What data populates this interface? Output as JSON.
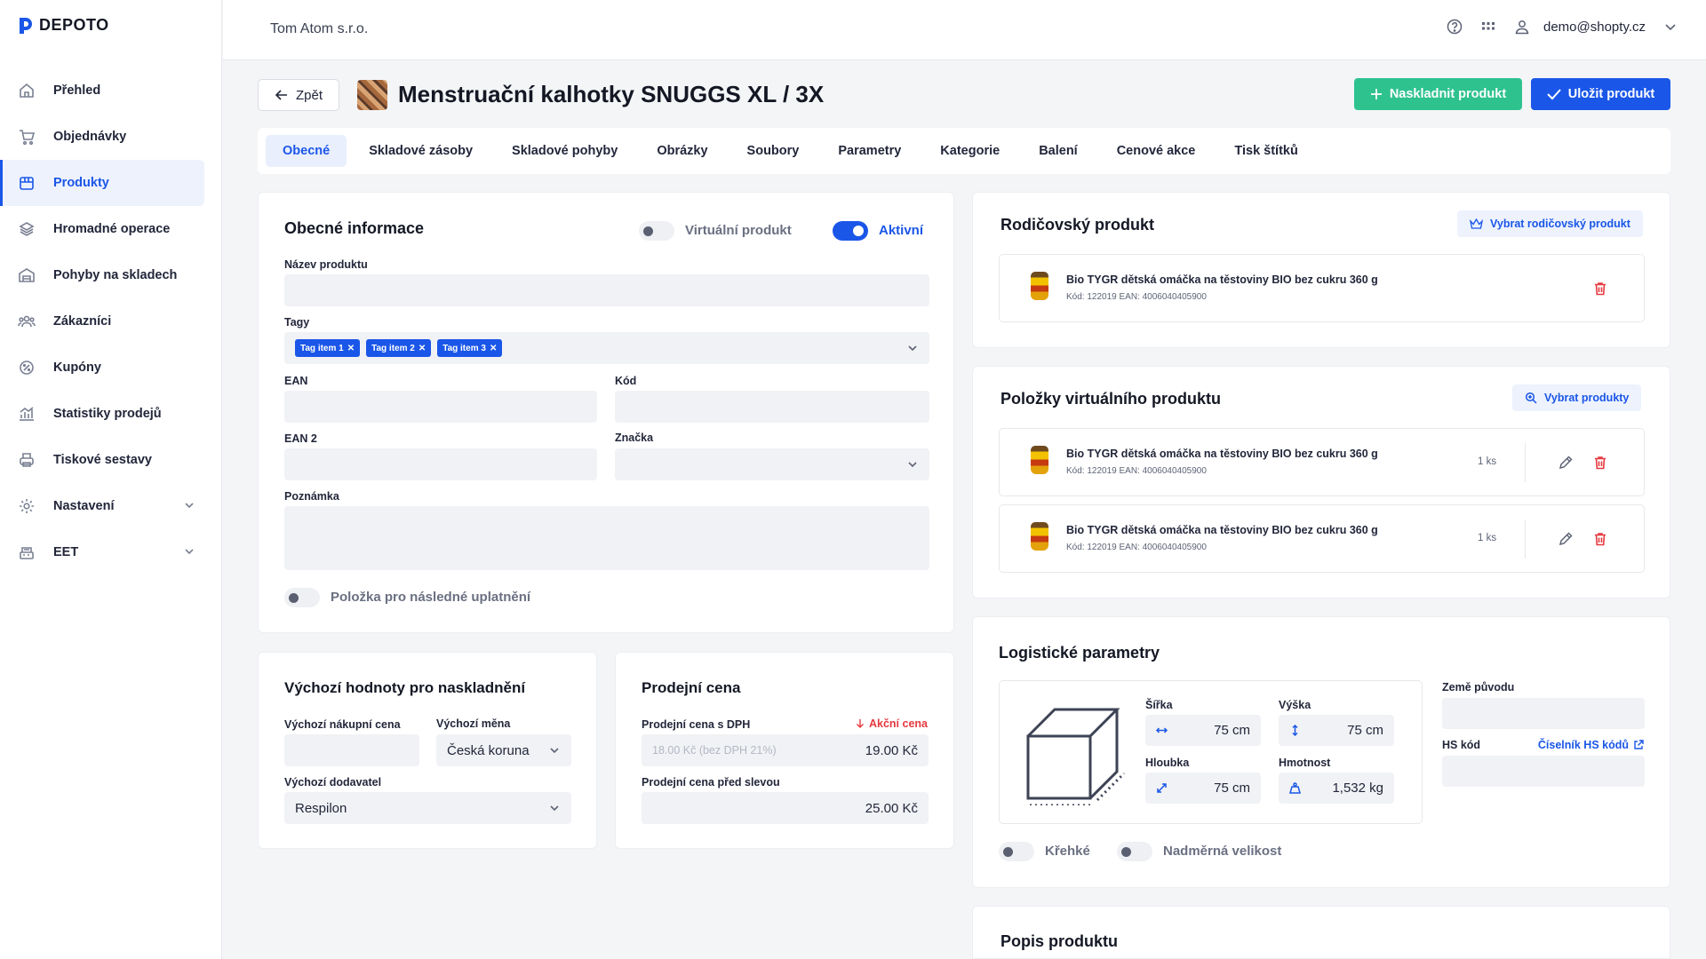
{
  "app": {
    "logo": "DEPOTO",
    "company": "Tom Atom s.r.o.",
    "user_email": "demo@shopty.cz"
  },
  "sidebar": {
    "items": [
      {
        "label": "Přehled",
        "icon": "home-icon"
      },
      {
        "label": "Objednávky",
        "icon": "cart-icon"
      },
      {
        "label": "Produkty",
        "icon": "box-icon",
        "active": true
      },
      {
        "label": "Hromadné operace",
        "icon": "layers-icon"
      },
      {
        "label": "Pohyby na skladech",
        "icon": "warehouse-icon"
      },
      {
        "label": "Zákazníci",
        "icon": "users-icon"
      },
      {
        "label": "Kupóny",
        "icon": "coupon-icon"
      },
      {
        "label": "Statistiky prodejů",
        "icon": "chart-icon"
      },
      {
        "label": "Tiskové sestavy",
        "icon": "printer-icon"
      },
      {
        "label": "Nastavení",
        "icon": "gear-icon",
        "expandable": true
      },
      {
        "label": "EET",
        "icon": "register-icon",
        "expandable": true
      }
    ]
  },
  "header": {
    "back_label": "Zpět",
    "title": "Menstruační kalhotky SNUGGS XL / 3X",
    "stock_button": "Naskladnit produkt",
    "save_button": "Uložit produkt"
  },
  "tabs": [
    "Obecné",
    "Skladové zásoby",
    "Skladové pohyby",
    "Obrázky",
    "Soubory",
    "Parametry",
    "Kategorie",
    "Balení",
    "Cenové akce",
    "Tisk štítků"
  ],
  "general": {
    "title": "Obecné informace",
    "virtual_label": "Virtuální produkt",
    "active_label": "Aktivní",
    "name_label": "Název produktu",
    "name_value": "",
    "tags_label": "Tagy",
    "tags": [
      "Tag item 1",
      "Tag item 2",
      "Tag item 3"
    ],
    "ean_label": "EAN",
    "ean_value": "",
    "code_label": "Kód",
    "code_value": "",
    "ean2_label": "EAN 2",
    "ean2_value": "",
    "brand_label": "Značka",
    "brand_value": "",
    "note_label": "Poznámka",
    "note_value": "",
    "later_label": "Položka pro následné uplatnění"
  },
  "defaults": {
    "title": "Výchozí hodnoty pro naskladnění",
    "purchase_label": "Výchozí nákupní cena",
    "purchase_value": "",
    "currency_label": "Výchozí měna",
    "currency_value": "Česká koruna",
    "supplier_label": "Výchozí dodavatel",
    "supplier_value": "Respilon"
  },
  "price": {
    "title": "Prodejní cena",
    "vat_label": "Prodejní cena s DPH",
    "promo_label": "Akční cena",
    "vat_hint": "18.00 Kč (bez DPH 21%)",
    "vat_value": "19.00 Kč",
    "before_label": "Prodejní cena před slevou",
    "before_value": "25.00 Kč"
  },
  "parent": {
    "title": "Rodičovský produkt",
    "select_button": "Vybrat rodičovský produkt",
    "product": {
      "name": "Bio TYGR dětská omáčka na těstoviny BIO bez cukru 360 g",
      "meta": "Kód: 122019    EAN: 4006040405900"
    }
  },
  "virtual_items": {
    "title": "Položky virtuálního produktu",
    "select_button": "Vybrat produkty",
    "items": [
      {
        "name": "Bio TYGR dětská omáčka na těstoviny BIO bez cukru 360 g",
        "meta": "Kód: 122019    EAN: 4006040405900",
        "qty": "1 ks"
      },
      {
        "name": "Bio TYGR dětská omáčka na těstoviny BIO bez cukru 360 g",
        "meta": "Kód: 122019    EAN: 4006040405900",
        "qty": "1 ks"
      }
    ]
  },
  "logistics": {
    "title": "Logistické parametry",
    "width_label": "Šířka",
    "width_value": "75 cm",
    "height_label": "Výška",
    "height_value": "75 cm",
    "depth_label": "Hloubka",
    "depth_value": "75 cm",
    "weight_label": "Hmotnost",
    "weight_value": "1,532 kg",
    "origin_label": "Země původu",
    "origin_value": "",
    "hs_label": "HS kód",
    "hs_link": "Číselník HS kódů",
    "hs_value": "",
    "fragile_label": "Křehké",
    "oversize_label": "Nadměrná velikost"
  },
  "description": {
    "title": "Popis produktu"
  },
  "colors": {
    "accent": "#1a56e8",
    "success": "#2ec28f",
    "danger": "#e5393f"
  }
}
